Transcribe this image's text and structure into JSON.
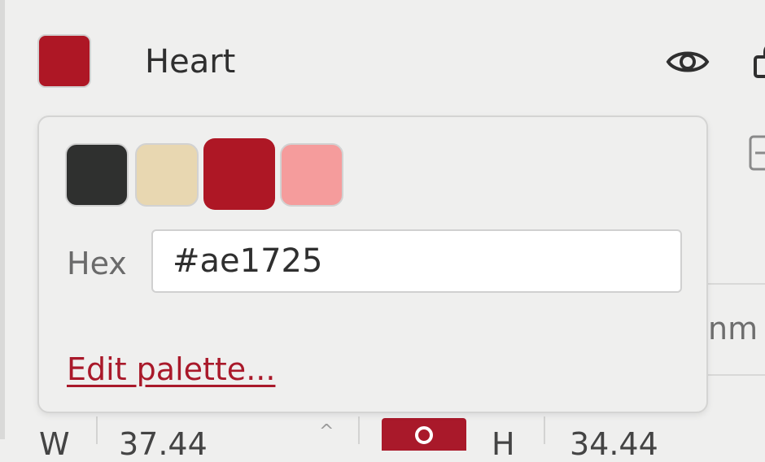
{
  "layer": {
    "name": "Heart",
    "color": "#ae1725",
    "visibility_icon": "eye-icon",
    "lock_icon": "lock-icon"
  },
  "color_popover": {
    "palette": [
      {
        "color": "#2f302f",
        "selected": false
      },
      {
        "color": "#e8d7b1",
        "selected": false
      },
      {
        "color": "#ae1725",
        "selected": true
      },
      {
        "color": "#f59c9c",
        "selected": false
      }
    ],
    "hex_label": "Hex",
    "hex_value": "#ae1725",
    "edit_palette_label": "Edit palette..."
  },
  "background_panel": {
    "unit_fragment": "nm",
    "width_label": "W",
    "width_value": "37.44",
    "height_label": "H",
    "height_value": "34.44",
    "accent": "#a9192a"
  }
}
